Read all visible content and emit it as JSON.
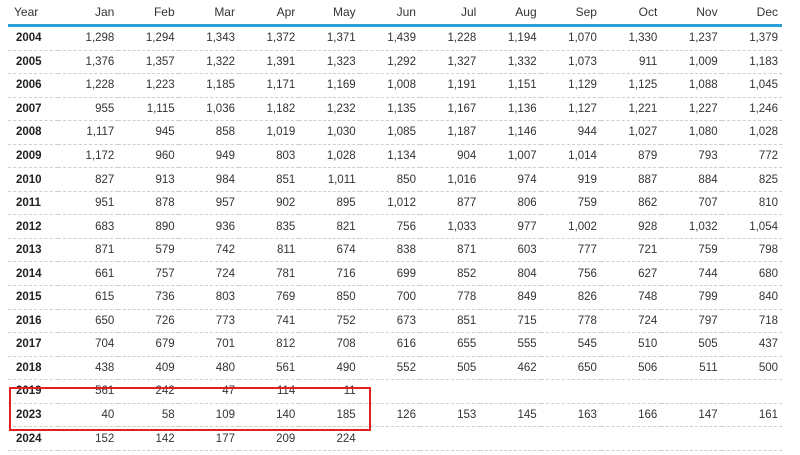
{
  "columns": [
    "Year",
    "Jan",
    "Feb",
    "Mar",
    "Apr",
    "May",
    "Jun",
    "Jul",
    "Aug",
    "Sep",
    "Oct",
    "Nov",
    "Dec"
  ],
  "rows": [
    {
      "year": "2004",
      "values": [
        "1,298",
        "1,294",
        "1,343",
        "1,372",
        "1,371",
        "1,439",
        "1,228",
        "1,194",
        "1,070",
        "1,330",
        "1,237",
        "1,379"
      ]
    },
    {
      "year": "2005",
      "values": [
        "1,376",
        "1,357",
        "1,322",
        "1,391",
        "1,323",
        "1,292",
        "1,327",
        "1,332",
        "1,073",
        "911",
        "1,009",
        "1,183"
      ]
    },
    {
      "year": "2006",
      "values": [
        "1,228",
        "1,223",
        "1,185",
        "1,171",
        "1,169",
        "1,008",
        "1,191",
        "1,151",
        "1,129",
        "1,125",
        "1,088",
        "1,045"
      ]
    },
    {
      "year": "2007",
      "values": [
        "955",
        "1,115",
        "1,036",
        "1,182",
        "1,232",
        "1,135",
        "1,167",
        "1,136",
        "1,127",
        "1,221",
        "1,227",
        "1,246"
      ]
    },
    {
      "year": "2008",
      "values": [
        "1,117",
        "945",
        "858",
        "1,019",
        "1,030",
        "1,085",
        "1,187",
        "1,146",
        "944",
        "1,027",
        "1,080",
        "1,028"
      ]
    },
    {
      "year": "2009",
      "values": [
        "1,172",
        "960",
        "949",
        "803",
        "1,028",
        "1,134",
        "904",
        "1,007",
        "1,014",
        "879",
        "793",
        "772"
      ]
    },
    {
      "year": "2010",
      "values": [
        "827",
        "913",
        "984",
        "851",
        "1,011",
        "850",
        "1,016",
        "974",
        "919",
        "887",
        "884",
        "825"
      ]
    },
    {
      "year": "2011",
      "values": [
        "951",
        "878",
        "957",
        "902",
        "895",
        "1,012",
        "877",
        "806",
        "759",
        "862",
        "707",
        "810"
      ]
    },
    {
      "year": "2012",
      "values": [
        "683",
        "890",
        "936",
        "835",
        "821",
        "756",
        "1,033",
        "977",
        "1,002",
        "928",
        "1,032",
        "1,054"
      ]
    },
    {
      "year": "2013",
      "values": [
        "871",
        "579",
        "742",
        "811",
        "674",
        "838",
        "871",
        "603",
        "777",
        "721",
        "759",
        "798"
      ]
    },
    {
      "year": "2014",
      "values": [
        "661",
        "757",
        "724",
        "781",
        "716",
        "699",
        "852",
        "804",
        "756",
        "627",
        "744",
        "680"
      ]
    },
    {
      "year": "2015",
      "values": [
        "615",
        "736",
        "803",
        "769",
        "850",
        "700",
        "778",
        "849",
        "826",
        "748",
        "799",
        "840"
      ]
    },
    {
      "year": "2016",
      "values": [
        "650",
        "726",
        "773",
        "741",
        "752",
        "673",
        "851",
        "715",
        "778",
        "724",
        "797",
        "718"
      ]
    },
    {
      "year": "2017",
      "values": [
        "704",
        "679",
        "701",
        "812",
        "708",
        "616",
        "655",
        "555",
        "545",
        "510",
        "505",
        "437"
      ]
    },
    {
      "year": "2018",
      "values": [
        "438",
        "409",
        "480",
        "561",
        "490",
        "552",
        "505",
        "462",
        "650",
        "506",
        "511",
        "500"
      ]
    },
    {
      "year": "2019",
      "values": [
        "561",
        "242",
        "47",
        "114",
        "11",
        "",
        "",
        "",
        "",
        "",
        "",
        ""
      ]
    },
    {
      "year": "2023",
      "values": [
        "40",
        "58",
        "109",
        "140",
        "185",
        "126",
        "153",
        "145",
        "163",
        "166",
        "147",
        "161"
      ]
    },
    {
      "year": "2024",
      "values": [
        "152",
        "142",
        "177",
        "209",
        "224",
        "",
        "",
        "",
        "",
        "",
        "",
        ""
      ]
    }
  ],
  "highlight": {
    "color": "#e02020"
  }
}
